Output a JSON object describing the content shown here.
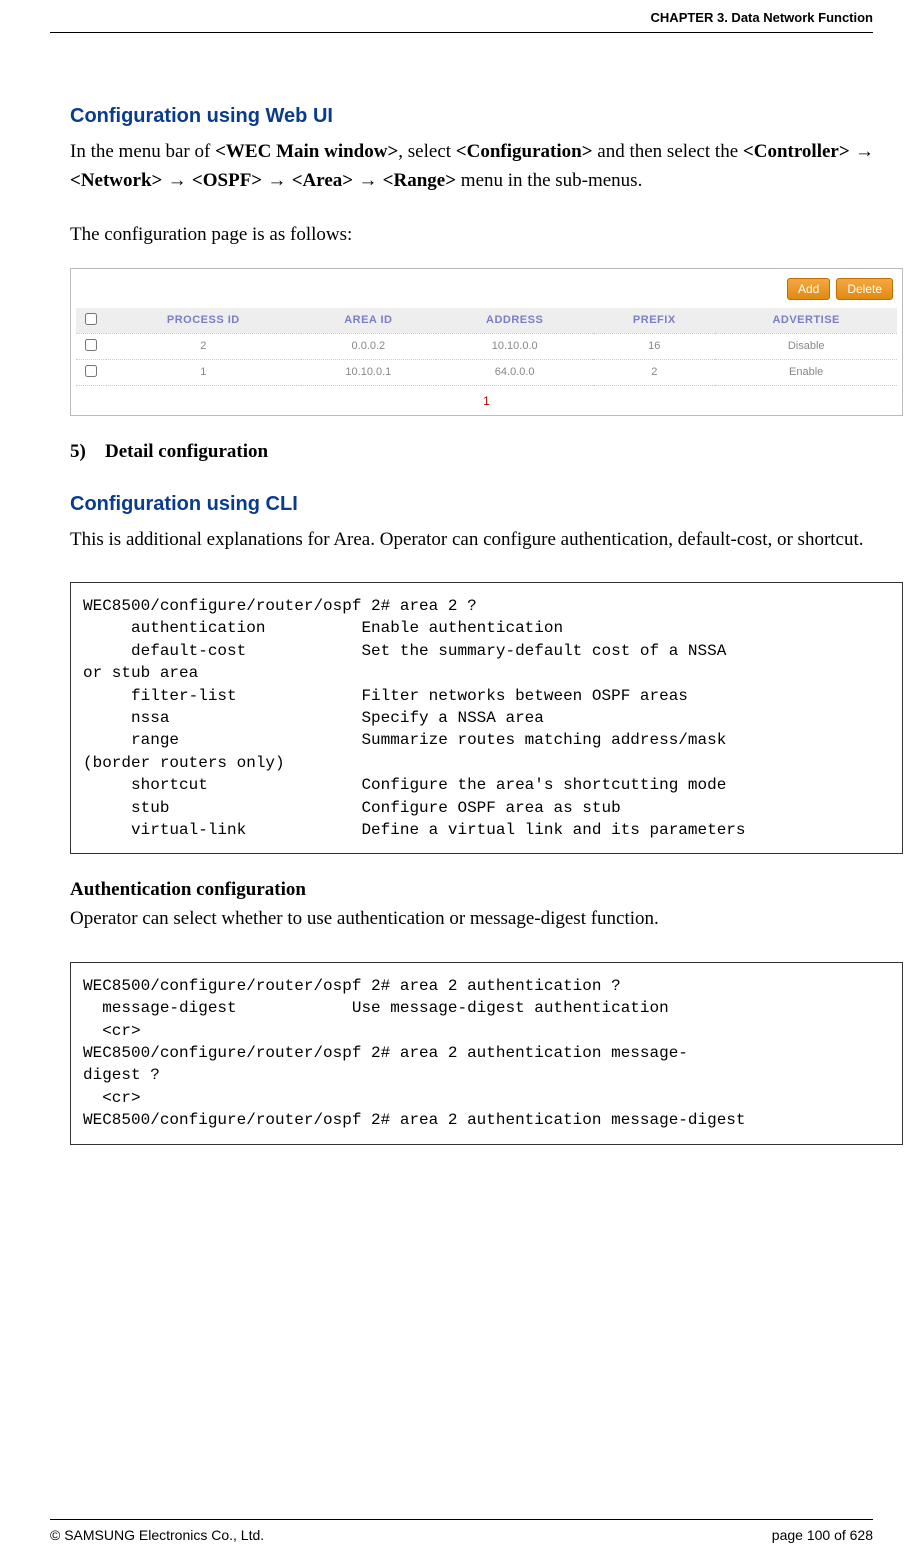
{
  "header": {
    "chapter": "CHAPTER 3. Data Network Function"
  },
  "section_webui": {
    "title": "Configuration using Web UI",
    "para1_a": "In the menu bar of ",
    "para1_b": "<WEC Main window>",
    "para1_c": ", select ",
    "para1_d": "<Configuration>",
    "para1_e": " and then select the ",
    "para1_f": "<Controller>",
    "arrow": " → ",
    "para1_g": "<Network>",
    "para1_h": "<OSPF>",
    "para1_i": "<Area>",
    "para1_j": "<Range>",
    "para1_k": " menu in the sub-menus.",
    "para2": "The configuration page is as follows:"
  },
  "table": {
    "buttons": {
      "add": "Add",
      "delete": "Delete"
    },
    "headers": [
      "PROCESS ID",
      "AREA ID",
      "ADDRESS",
      "PREFIX",
      "ADVERTISE"
    ],
    "rows": [
      {
        "process_id": "2",
        "area_id": "0.0.0.2",
        "address": "10.10.0.0",
        "prefix": "16",
        "advertise": "Disable"
      },
      {
        "process_id": "1",
        "area_id": "10.10.0.1",
        "address": "64.0.0.0",
        "prefix": "2",
        "advertise": "Enable"
      }
    ],
    "pagination": "1"
  },
  "section_detail": {
    "num": "5)",
    "title": "Detail configuration"
  },
  "section_cli": {
    "title": "Configuration using CLI",
    "para": "This is additional explanations for Area. Operator can configure authentication, default-cost, or shortcut."
  },
  "code1": "WEC8500/configure/router/ospf 2# area 2 ?\n     authentication          Enable authentication\n     default-cost            Set the summary-default cost of a NSSA \nor stub area\n     filter-list             Filter networks between OSPF areas\n     nssa                    Specify a NSSA area\n     range                   Summarize routes matching address/mask \n(border routers only)\n     shortcut                Configure the area's shortcutting mode\n     stub                    Configure OSPF area as stub\n     virtual-link            Define a virtual link and its parameters",
  "auth": {
    "title": "Authentication configuration",
    "para": "Operator can select whether to use authentication or message-digest function."
  },
  "code2": "WEC8500/configure/router/ospf 2# area 2 authentication ?\n  message-digest            Use message-digest authentication\n  <cr>\nWEC8500/configure/router/ospf 2# area 2 authentication message-\ndigest ?\n  <cr>\nWEC8500/configure/router/ospf 2# area 2 authentication message-digest",
  "footer": {
    "copyright": "© SAMSUNG Electronics Co., Ltd.",
    "page": "page 100 of 628"
  }
}
